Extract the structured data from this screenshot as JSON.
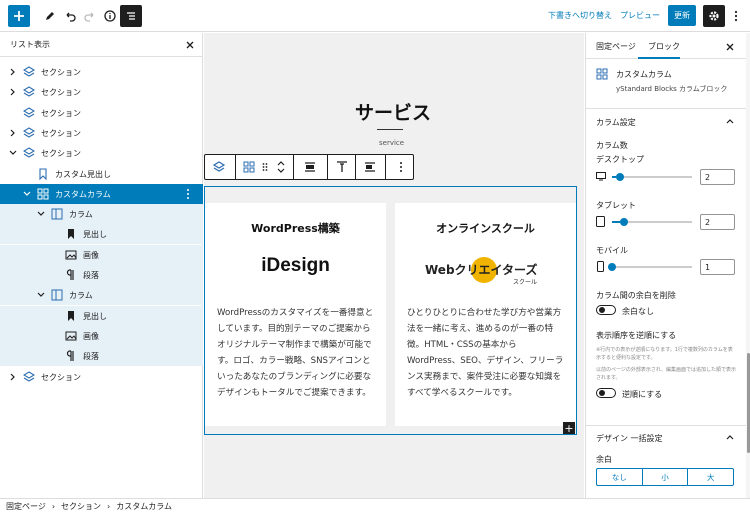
{
  "toolbar": {
    "add_icon": "plus-icon",
    "draft_switch": "下書きへ切り替え",
    "preview": "プレビュー",
    "update": "更新"
  },
  "list_view": {
    "title": "リスト表示",
    "rows": [
      {
        "label": "セクション"
      },
      {
        "label": "セクション"
      },
      {
        "label": "セクション"
      },
      {
        "label": "セクション"
      },
      {
        "label": "セクション"
      },
      {
        "label": "カスタム見出し"
      },
      {
        "label": "カスタムカラム"
      },
      {
        "label": "カラム"
      },
      {
        "label": "見出し"
      },
      {
        "label": "画像"
      },
      {
        "label": "段落"
      },
      {
        "label": "カラム"
      },
      {
        "label": "見出し"
      },
      {
        "label": "画像"
      },
      {
        "label": "段落"
      },
      {
        "label": "セクション"
      }
    ]
  },
  "canvas": {
    "heading": "サービス",
    "subheading": "service",
    "cards": [
      {
        "title": "WordPress構築",
        "logo": "iDesign",
        "body": "WordPressのカスタマイズを一番得意としています。目的別テーマのご提案からオリジナルテーマ制作まで構築が可能です。ロゴ、カラー戦略、SNSアイコンといったあなたのブランディングに必要なデザインもトータルでご提案できます。"
      },
      {
        "title": "オンラインスクール",
        "logo_main": "Webクリエイターズ",
        "logo_sub": "スクール",
        "body": "ひとりひとりに合わせた学び方や営業方法を一緒に考え、進めるのが一番の特徴。HTML・CSSの基本からWordPress、SEO、デザイン、フリーランス実務まで、案件受注に必要な知識をすべて学べるスクールです。"
      }
    ]
  },
  "sidebar": {
    "tab_page": "固定ページ",
    "tab_block": "ブロック",
    "block_name": "カスタムカラム",
    "block_desc": "yStandard Blocks カラムブロック",
    "column_settings": "カラム設定",
    "column_count": "カラム数",
    "desktop": "デスクトップ",
    "desktop_val": "2",
    "desktop_level": 0.05,
    "tablet": "タブレット",
    "tablet_val": "2",
    "tablet_level": 0.1,
    "mobile": "モバイル",
    "mobile_val": "1",
    "mobile_level": 0.0,
    "no_gap_label": "カラム間の余白を削除",
    "no_gap_toggle": "余白なし",
    "reverse_label": "表示順序を逆順にする",
    "reverse_help1": "※行内での表示が逆順になります。1行で複数列のカラムを表示すると便利な設定です。",
    "reverse_help2": "以前のページの外部表示され、編集画面では追加した順で表示されます。",
    "reverse_toggle": "逆順にする",
    "design_preset": "デザイン 一括設定",
    "margin": "余白",
    "margin_opts": [
      "なし",
      "小",
      "大"
    ]
  },
  "breadcrumb": [
    "固定ページ",
    "セクション",
    "カスタムカラム"
  ],
  "colors": {
    "accent": "#007cba",
    "dark": "#1e1e1e"
  }
}
